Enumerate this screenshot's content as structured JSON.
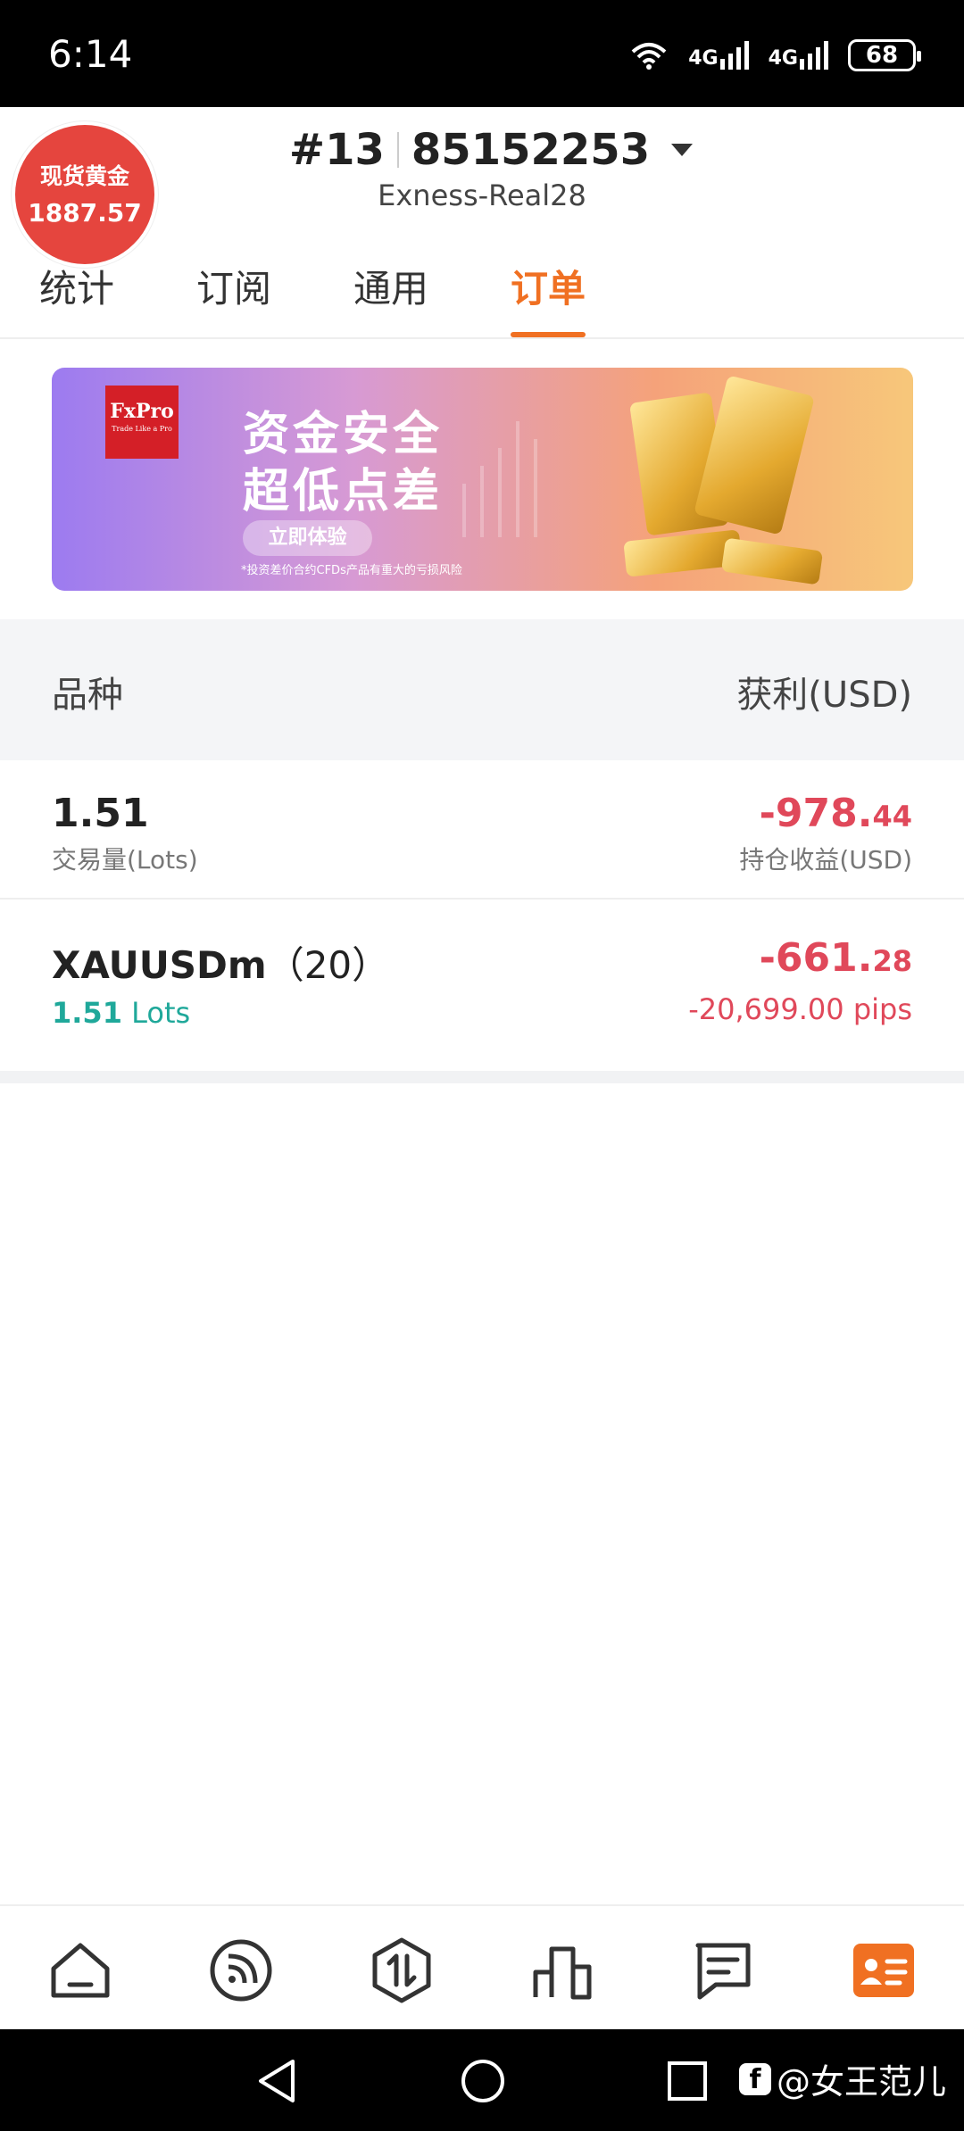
{
  "status_bar": {
    "time": "6:14",
    "net1": "4G",
    "net2": "4G",
    "battery": "68"
  },
  "gold_badge": {
    "label": "现货黄金",
    "price": "1887.57"
  },
  "account": {
    "number_prefix": "#13",
    "number": "85152253",
    "server": "Exness-Real28"
  },
  "tabs": [
    {
      "label": "统计"
    },
    {
      "label": "订阅"
    },
    {
      "label": "通用"
    },
    {
      "label": "订单"
    }
  ],
  "active_tab": "订单",
  "banner": {
    "logo": "FxPro",
    "logo_sub": "Trade Like a Pro",
    "title1": "资金安全",
    "title2": "超低点差",
    "button": "立即体验",
    "note": "*投资差价合约CFDs产品有重大的亏损风险"
  },
  "list": {
    "col_left": "品种",
    "col_right": "获利(USD)",
    "summary": {
      "lots": "1.51",
      "lots_label": "交易量(Lots)",
      "profit_main": "-978.",
      "profit_dec": "44",
      "profit_label": "持仓收益(USD)"
    },
    "orders": [
      {
        "symbol": "XAUUSDm",
        "count": "（20）",
        "lots_value": "1.51",
        "lots_unit": "Lots",
        "profit_main": "-661.",
        "profit_dec": "28",
        "pips": "-20,699.00 pips"
      }
    ]
  },
  "bottom_nav": [
    {
      "icon": "home-icon"
    },
    {
      "icon": "feed-icon"
    },
    {
      "icon": "trade-icon"
    },
    {
      "icon": "chart-icon"
    },
    {
      "icon": "message-icon"
    },
    {
      "icon": "profile-card-icon"
    }
  ],
  "watermark": "@女王范儿",
  "colors": {
    "accent": "#f07022",
    "loss": "#e0485a",
    "lots_green": "#1fa89a",
    "badge_red": "#e5453e"
  }
}
